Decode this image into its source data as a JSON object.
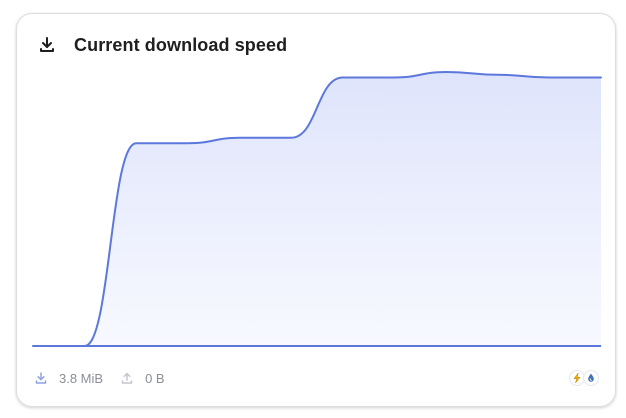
{
  "widget": {
    "title": "Current download speed",
    "header_icon": "download-icon"
  },
  "stats": {
    "download": {
      "icon": "download-icon",
      "value": "3.8 MiB"
    },
    "upload": {
      "icon": "upload-icon",
      "value": "0 B"
    }
  },
  "providers": [
    {
      "icon": "bolt-app-icon"
    },
    {
      "icon": "drop-app-icon"
    }
  ],
  "chart_data": {
    "type": "area",
    "title": "",
    "xlabel": "",
    "ylabel": "",
    "grid": false,
    "ylim": [
      0,
      1
    ],
    "x": [
      0,
      1,
      2,
      3,
      4,
      5,
      6,
      7,
      8,
      9,
      10,
      11
    ],
    "series": [
      {
        "values": [
          0,
          0,
          0.74,
          0.74,
          0.76,
          0.76,
          0.98,
          0.98,
          1.0,
          0.99,
          0.98,
          0.98
        ]
      }
    ],
    "colors": {
      "line": "#5c78dc",
      "fill_top": "#dee4fb",
      "fill_bottom": "#f8f9ff",
      "baseline": "#5c78dc"
    }
  }
}
